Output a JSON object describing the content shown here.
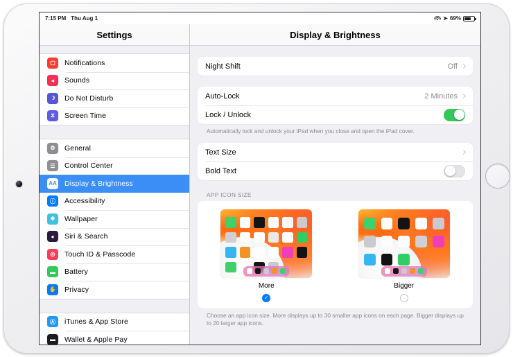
{
  "status_bar": {
    "time": "7:15 PM",
    "date": "Thu Aug 1",
    "battery_percent": "69%",
    "wifi_icon": "wifi-icon",
    "location_icon": "location-arrow-icon",
    "battery_icon": "battery-icon",
    "battery_level": 69
  },
  "sidebar": {
    "title": "Settings",
    "groups": [
      {
        "items": [
          {
            "label": "Notifications",
            "icon": "notifications-icon",
            "glyph": "▢",
            "color": "#ff3b30",
            "selected": false
          },
          {
            "label": "Sounds",
            "icon": "sounds-icon",
            "glyph": "◂",
            "color": "#fa2d55",
            "selected": false
          },
          {
            "label": "Do Not Disturb",
            "icon": "moon-icon",
            "glyph": "☽",
            "color": "#5856d6",
            "selected": false
          },
          {
            "label": "Screen Time",
            "icon": "hourglass-icon",
            "glyph": "⧖",
            "color": "#5e5ce6",
            "selected": false
          }
        ]
      },
      {
        "items": [
          {
            "label": "General",
            "icon": "gear-icon",
            "glyph": "⚙",
            "color": "#8e8e93",
            "selected": false
          },
          {
            "label": "Control Center",
            "icon": "sliders-icon",
            "glyph": "☰",
            "color": "#8e8e93",
            "selected": false
          },
          {
            "label": "Display & Brightness",
            "icon": "text-size-aa-icon",
            "glyph": "AA",
            "color": "#3a8ef6",
            "selected": true
          },
          {
            "label": "Accessibility",
            "icon": "accessibility-icon",
            "glyph": "ⓘ",
            "color": "#007aff",
            "selected": false
          },
          {
            "label": "Wallpaper",
            "icon": "wallpaper-icon",
            "glyph": "❉",
            "color": "#3ec2e0",
            "selected": false
          },
          {
            "label": "Siri & Search",
            "icon": "siri-icon",
            "glyph": "●",
            "color": "#2b1b3d",
            "selected": false
          },
          {
            "label": "Touch ID & Passcode",
            "icon": "fingerprint-icon",
            "glyph": "◎",
            "color": "#f83e5a",
            "selected": false
          },
          {
            "label": "Battery",
            "icon": "battery-icon",
            "glyph": "▬",
            "color": "#34c759",
            "selected": false
          },
          {
            "label": "Privacy",
            "icon": "hand-raised-icon",
            "glyph": "✋",
            "color": "#007aff",
            "selected": false
          }
        ]
      },
      {
        "items": [
          {
            "label": "iTunes & App Store",
            "icon": "app-store-icon",
            "glyph": "Ⓐ",
            "color": "#2196f3",
            "selected": false
          },
          {
            "label": "Wallet & Apple Pay",
            "icon": "wallet-icon",
            "glyph": "▬",
            "color": "#1c1c1e",
            "selected": false
          }
        ]
      }
    ]
  },
  "detail": {
    "title": "Display & Brightness",
    "night_shift": {
      "label": "Night Shift",
      "value": "Off",
      "chevron": "chevron-right-icon"
    },
    "auto_lock": {
      "label": "Auto-Lock",
      "value": "2 Minutes",
      "chevron": "chevron-right-icon"
    },
    "lock_unlock": {
      "label": "Lock / Unlock",
      "state": "on"
    },
    "lock_unlock_footnote": "Automatically lock and unlock your iPad when you close and open the iPad cover.",
    "text_size": {
      "label": "Text Size",
      "chevron": "chevron-right-icon"
    },
    "bold_text": {
      "label": "Bold Text",
      "state": "off"
    },
    "app_icon_size": {
      "section_header": "APP ICON SIZE",
      "options": [
        {
          "label": "More",
          "selected": true,
          "check": "✓",
          "grid": "more"
        },
        {
          "label": "Bigger",
          "selected": false,
          "check": "",
          "grid": "bigger"
        }
      ],
      "footnote": "Choose an app icon size. More displays up to 30 smaller app icons on each page. Bigger displays up to 20 larger app icons."
    }
  }
}
